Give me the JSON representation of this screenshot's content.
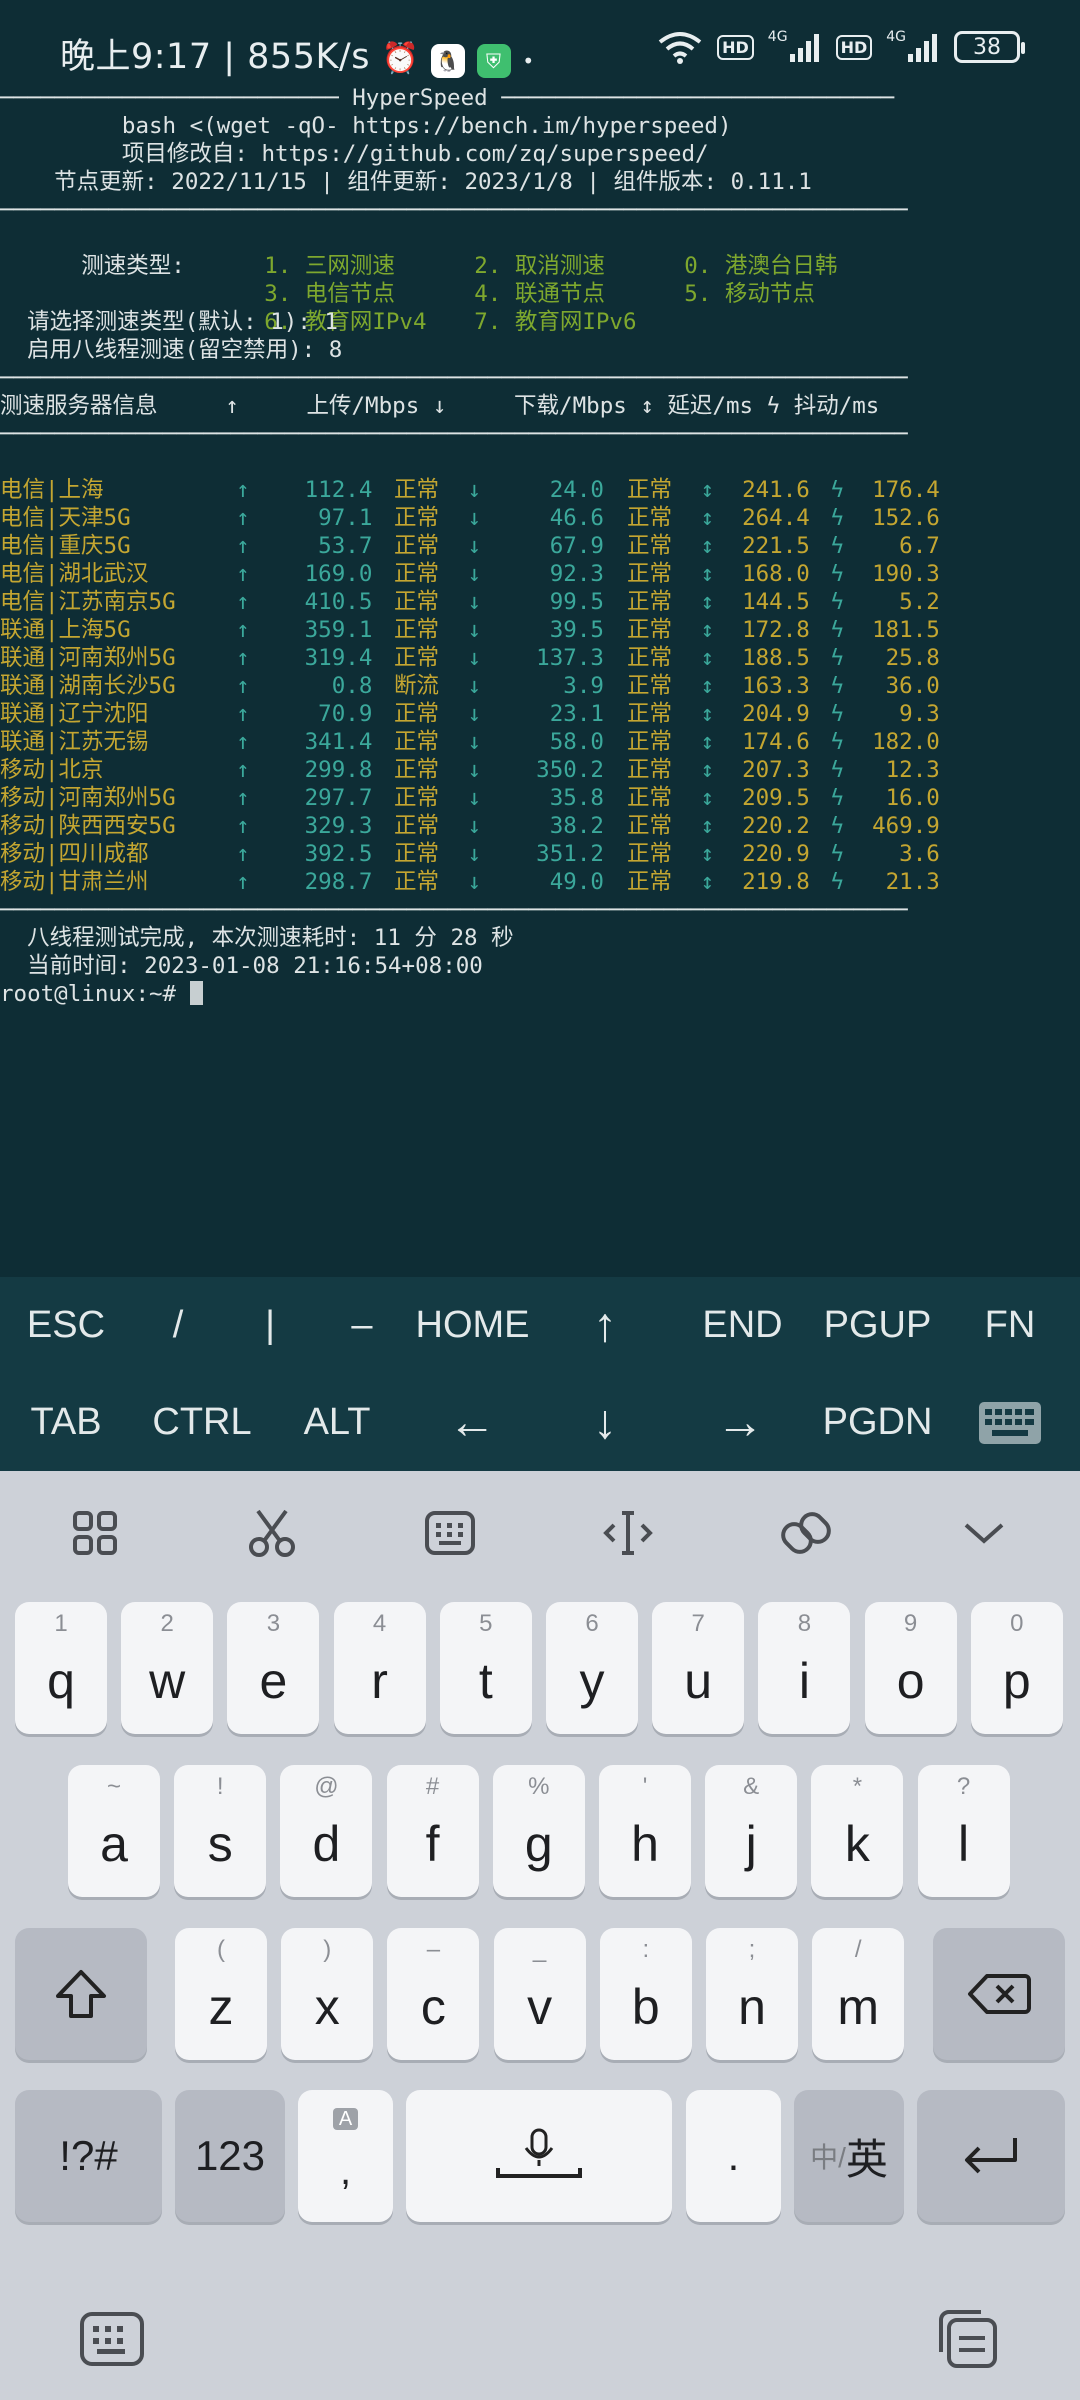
{
  "status": {
    "time": "晚上9:17",
    "speed": "855K/s",
    "battery": "38",
    "net1": "4G",
    "net2": "4G",
    "hd": "HD"
  },
  "terminal": {
    "sep1": "───────────────────────── HyperSpeed ─────────────────────────────",
    "cmd": "         bash <(wget -qO- https://bench.im/hyperspeed)",
    "modified": "         项目修改自: https://github.com/zq/superspeed/",
    "update": "    节点更新: 2022/11/15 | 组件更新: 2023/1/8 | 组件版本: 0.11.1",
    "sep2": "───────────────────────────────────────────────────────────────────",
    "menu_label": "  测速类型:  ",
    "menu": [
      [
        "1. 三网测速",
        "2. 取消测速",
        "0. 港澳台日韩"
      ],
      [
        "3. 电信节点",
        "4. 联通节点",
        "5. 移动节点"
      ],
      [
        "6. 教育网IPv4",
        "7. 教育网IPv6",
        ""
      ]
    ],
    "prompt1": "  请选择测速类型(默认: 1): 1",
    "prompt2": "  启用八线程测速(留空禁用): 8",
    "sep3": "───────────────────────────────────────────────────────────────────",
    "header": "测速服务器信息     ↑     上传/Mbps ↓     下载/Mbps ↕ 延迟/ms ϟ 抖动/ms",
    "sep4": "───────────────────────────────────────────────────────────────────",
    "rows": [
      {
        "name": "电信|上海",
        "up": "112.4",
        "ups": "正常",
        "down": "24.0",
        "downs": "正常",
        "lat": "241.6",
        "jit": "176.4"
      },
      {
        "name": "电信|天津5G",
        "up": "97.1",
        "ups": "正常",
        "down": "46.6",
        "downs": "正常",
        "lat": "264.4",
        "jit": "152.6"
      },
      {
        "name": "电信|重庆5G",
        "up": "53.7",
        "ups": "正常",
        "down": "67.9",
        "downs": "正常",
        "lat": "221.5",
        "jit": "6.7"
      },
      {
        "name": "电信|湖北武汉",
        "up": "169.0",
        "ups": "正常",
        "down": "92.3",
        "downs": "正常",
        "lat": "168.0",
        "jit": "190.3"
      },
      {
        "name": "电信|江苏南京5G",
        "up": "410.5",
        "ups": "正常",
        "down": "99.5",
        "downs": "正常",
        "lat": "144.5",
        "jit": "5.2"
      },
      {
        "name": "联通|上海5G",
        "up": "359.1",
        "ups": "正常",
        "down": "39.5",
        "downs": "正常",
        "lat": "172.8",
        "jit": "181.5"
      },
      {
        "name": "联通|河南郑州5G",
        "up": "319.4",
        "ups": "正常",
        "down": "137.3",
        "downs": "正常",
        "lat": "188.5",
        "jit": "25.8"
      },
      {
        "name": "联通|湖南长沙5G",
        "up": "0.8",
        "ups": "断流",
        "down": "3.9",
        "downs": "正常",
        "lat": "163.3",
        "jit": "36.0"
      },
      {
        "name": "联通|辽宁沈阳",
        "up": "70.9",
        "ups": "正常",
        "down": "23.1",
        "downs": "正常",
        "lat": "204.9",
        "jit": "9.3"
      },
      {
        "name": "联通|江苏无锡",
        "up": "341.4",
        "ups": "正常",
        "down": "58.0",
        "downs": "正常",
        "lat": "174.6",
        "jit": "182.0"
      },
      {
        "name": "移动|北京",
        "up": "299.8",
        "ups": "正常",
        "down": "350.2",
        "downs": "正常",
        "lat": "207.3",
        "jit": "12.3"
      },
      {
        "name": "移动|河南郑州5G",
        "up": "297.7",
        "ups": "正常",
        "down": "35.8",
        "downs": "正常",
        "lat": "209.5",
        "jit": "16.0"
      },
      {
        "name": "移动|陕西西安5G",
        "up": "329.3",
        "ups": "正常",
        "down": "38.2",
        "downs": "正常",
        "lat": "220.2",
        "jit": "469.9"
      },
      {
        "name": "移动|四川成都",
        "up": "392.5",
        "ups": "正常",
        "down": "351.2",
        "downs": "正常",
        "lat": "220.9",
        "jit": "3.6"
      },
      {
        "name": "移动|甘肃兰州",
        "up": "298.7",
        "ups": "正常",
        "down": "49.0",
        "downs": "正常",
        "lat": "219.8",
        "jit": "21.3"
      }
    ],
    "sep5": "───────────────────────────────────────────────────────────────────",
    "done": "  八线程测试完成, 本次测速耗时: 11 分 28 秒",
    "now": "  当前时间: 2023-01-08 21:16:54+08:00",
    "shell_prompt": "root@linux:~# "
  },
  "extra_keys": {
    "row1": [
      "ESC",
      "/",
      "|",
      "–",
      "HOME",
      "↑",
      "END",
      "PGUP",
      "FN"
    ],
    "row2": [
      "TAB",
      "CTRL",
      "ALT",
      "←",
      "↓",
      "→",
      "PGDN"
    ]
  },
  "keyboard": {
    "row1": [
      [
        "q",
        "1"
      ],
      [
        "w",
        "2"
      ],
      [
        "e",
        "3"
      ],
      [
        "r",
        "4"
      ],
      [
        "t",
        "5"
      ],
      [
        "y",
        "6"
      ],
      [
        "u",
        "7"
      ],
      [
        "i",
        "8"
      ],
      [
        "o",
        "9"
      ],
      [
        "p",
        "0"
      ]
    ],
    "row2": [
      [
        "a",
        "~"
      ],
      [
        "s",
        "!"
      ],
      [
        "d",
        "@"
      ],
      [
        "f",
        "#"
      ],
      [
        "g",
        "%"
      ],
      [
        "h",
        "'"
      ],
      [
        "j",
        "&"
      ],
      [
        "k",
        "*"
      ],
      [
        "l",
        "?"
      ]
    ],
    "row3": [
      [
        "z",
        "("
      ],
      [
        "x",
        ")"
      ],
      [
        "c",
        "–"
      ],
      [
        "v",
        "_"
      ],
      [
        "b",
        ":"
      ],
      [
        "n",
        ";"
      ],
      [
        "m",
        "/"
      ]
    ],
    "symbols_label": "!?#",
    "num_label": "123",
    "comma": ",",
    "comma_hint": "A",
    "period": ".",
    "lang_label_small": "中/",
    "lang_label_big": "英"
  }
}
